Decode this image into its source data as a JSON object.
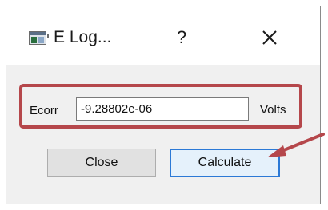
{
  "window": {
    "title": "E Log...",
    "help_glyph": "?",
    "close_glyph": "×"
  },
  "form": {
    "ecorr_label": "Ecorr",
    "ecorr_value": "-9.28802e-06",
    "units_label": "Volts"
  },
  "buttons": {
    "close_label": "Close",
    "calculate_label": "Calculate"
  },
  "colors": {
    "highlight": "#b5474b",
    "default_button_border": "#2b79d6"
  },
  "icons": [
    "app-window-icon",
    "help-icon",
    "close-icon",
    "annotation-arrow-icon"
  ]
}
